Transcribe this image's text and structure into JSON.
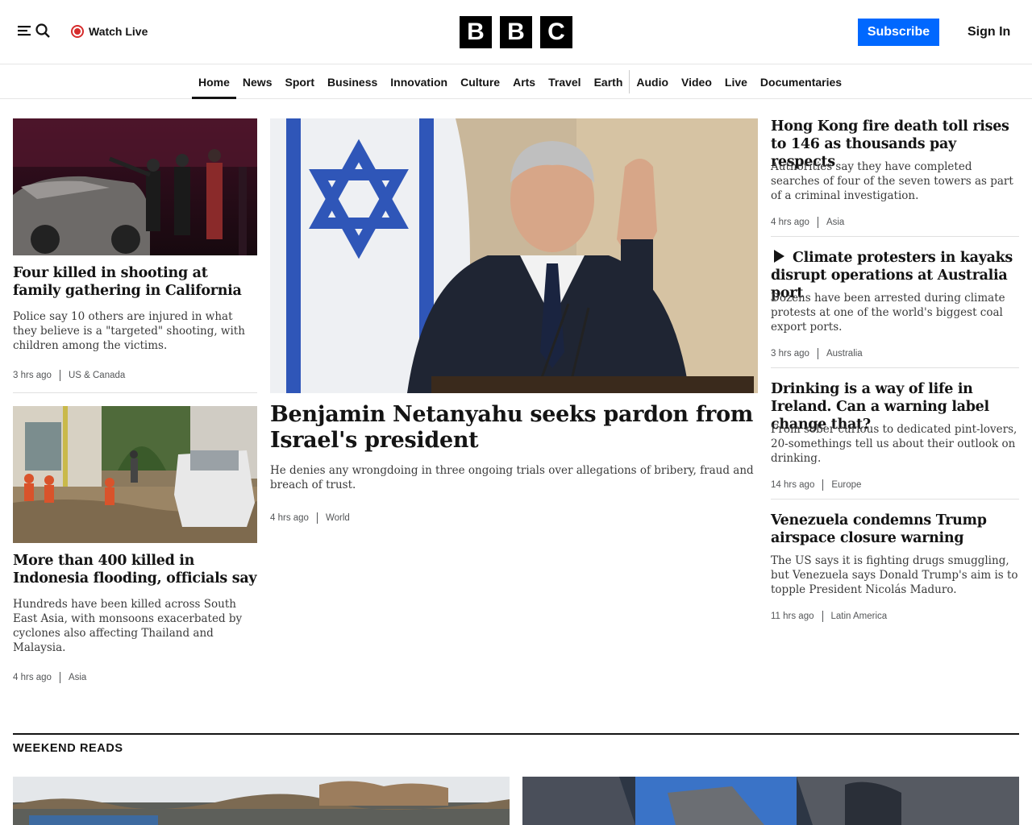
{
  "header": {
    "watch_live": "Watch Live",
    "logo": [
      "B",
      "B",
      "C"
    ],
    "subscribe": "Subscribe",
    "sign_in": "Sign In"
  },
  "nav": {
    "items": [
      "Home",
      "News",
      "Sport",
      "Business",
      "Innovation",
      "Culture",
      "Arts",
      "Travel",
      "Earth",
      "Audio",
      "Video",
      "Live",
      "Documentaries"
    ]
  },
  "left": [
    {
      "headline": "Four killed in shooting at family gathering in California",
      "summary": "Police say 10 others are injured in what they believe is a \"targeted\" shooting, with children among the victims.",
      "time": "3 hrs ago",
      "tag": "US & Canada"
    },
    {
      "headline": "More than 400 killed in Indonesia flooding, officials say",
      "summary": "Hundreds have been killed across South East Asia, with monsoons exacerbated by cyclones also affecting Thailand and Malaysia.",
      "time": "4 hrs ago",
      "tag": "Asia"
    }
  ],
  "main": {
    "headline": "Benjamin Netanyahu seeks pardon from Israel's president",
    "summary": "He denies any wrongdoing in three ongoing trials over allegations of bribery, fraud and breach of trust.",
    "time": "4 hrs ago",
    "tag": "World"
  },
  "right": [
    {
      "headline": "Hong Kong fire death toll rises to 146 as thousands pay respects",
      "summary": "Authorities say they have completed searches of four of the seven towers as part of a criminal investigation.",
      "time": "4 hrs ago",
      "tag": "Asia"
    },
    {
      "headline": "Climate protesters in kayaks disrupt operations at Australia port",
      "summary": "Dozens have been arrested during climate protests at one of the world's biggest coal export ports.",
      "time": "3 hrs ago",
      "tag": "Australia"
    },
    {
      "headline": "Drinking is a way of life in Ireland. Can a warning label change that?",
      "summary": "From sober curious to dedicated pint-lovers, 20-somethings tell us about their outlook on drinking.",
      "time": "14 hrs ago",
      "tag": "Europe"
    },
    {
      "headline": "Venezuela condemns Trump airspace closure warning",
      "summary": "The US says it is fighting drugs smuggling, but Venezuela says Donald Trump's aim is to topple President Nicolás Maduro.",
      "time": "11 hrs ago",
      "tag": "Latin America"
    }
  ],
  "section": {
    "title": "WEEKEND READS"
  },
  "colors": {
    "accent": "#0068ff",
    "live": "#d62c2c",
    "text": "#141414"
  }
}
